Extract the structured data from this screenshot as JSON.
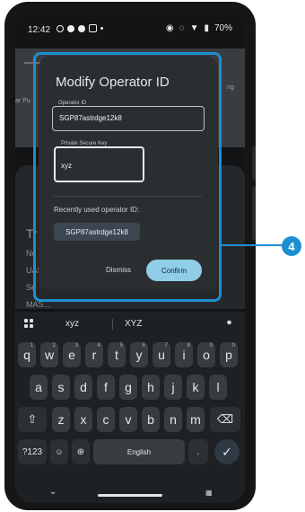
{
  "status_bar": {
    "time": "12:42",
    "battery": "70%"
  },
  "map": {
    "label_left": "ar Pu",
    "label_right": "ng"
  },
  "background_sheet": {
    "title_fragment": "Tr",
    "row1": "Ne",
    "row2": "UAS",
    "row3": "Se",
    "row4": "MAS..."
  },
  "dialog": {
    "title": "Modify Operator ID",
    "operator_id_label": "Operator ID",
    "operator_id_value": "SGP87astrdge12k8",
    "secure_key_label": "Private Secure Key",
    "secure_key_value": "xyz",
    "recent_label": "Recently used operator ID:",
    "recent_chip": "SGP87astrdge12k8",
    "dismiss": "Dismiss",
    "confirm": "Confirm"
  },
  "callout": {
    "number": "4"
  },
  "keyboard": {
    "suggestions": [
      "xyz",
      "XYZ"
    ],
    "row1": [
      {
        "k": "q",
        "h": "1"
      },
      {
        "k": "w",
        "h": "2"
      },
      {
        "k": "e",
        "h": "3"
      },
      {
        "k": "r",
        "h": "4"
      },
      {
        "k": "t",
        "h": "5"
      },
      {
        "k": "y",
        "h": "6"
      },
      {
        "k": "u",
        "h": "7"
      },
      {
        "k": "i",
        "h": "8"
      },
      {
        "k": "o",
        "h": "9"
      },
      {
        "k": "p",
        "h": "0"
      }
    ],
    "row2": [
      "a",
      "s",
      "d",
      "f",
      "g",
      "h",
      "j",
      "k",
      "l"
    ],
    "row3": [
      "z",
      "x",
      "c",
      "v",
      "b",
      "n",
      "m"
    ],
    "shift": "⇧",
    "backspace": "⌫",
    "symbols": "?123",
    "space_label": "English",
    "period": ".",
    "enter": "✓",
    "mic": "🎤",
    "globe": "🌐"
  },
  "colors": {
    "accent": "#1b8fd2",
    "confirm": "#90cde7"
  }
}
